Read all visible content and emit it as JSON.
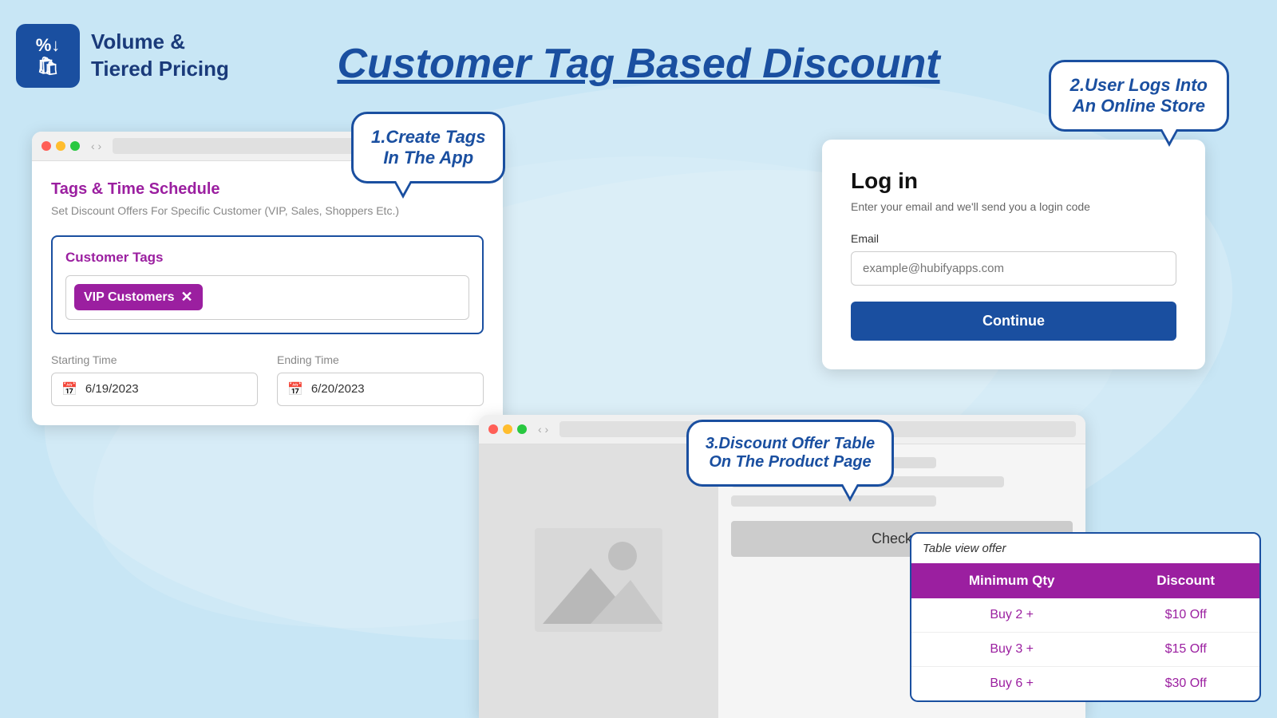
{
  "app": {
    "logo_line1": "%↓",
    "logo_line2": "🛍",
    "name_line1": "Volume &",
    "name_line2": "Tiered Pricing"
  },
  "page_title": "Customer Tag Based Discount",
  "bubble1": {
    "line1": "1.Create Tags",
    "line2": "In The App"
  },
  "bubble2": {
    "line1": "2.User Logs Into",
    "line2": "An Online Store"
  },
  "bubble3": {
    "line1": "3.Discount Offer Table",
    "line2": "On The Product Page"
  },
  "app_window": {
    "section_title": "Tags & Time Schedule",
    "section_desc": "Set Discount Offers For Specific Customer (VIP, Sales, Shoppers Etc.)",
    "customer_tags_label": "Customer Tags",
    "tag": "VIP Customers",
    "starting_time_label": "Starting Time",
    "starting_time_value": "6/19/2023",
    "ending_time_label": "Ending Time",
    "ending_time_value": "6/20/2023"
  },
  "login": {
    "title": "Log in",
    "subtitle": "Enter your email and we'll send you a login code",
    "email_label": "Email",
    "email_placeholder": "example@hubifyapps.com",
    "button_label": "Continue"
  },
  "product_page": {
    "checkout_label": "Checkout",
    "table_label": "Table view offer",
    "table_headers": [
      "Minimum Qty",
      "Discount"
    ],
    "table_rows": [
      [
        "Buy 2 +",
        "$10 Off"
      ],
      [
        "Buy 3 +",
        "$15 Off"
      ],
      [
        "Buy 6 +",
        "$30 Off"
      ]
    ]
  },
  "colors": {
    "brand_blue": "#1a4fa0",
    "brand_purple": "#9b1fa0",
    "light_bg": "#d0eaf8"
  }
}
